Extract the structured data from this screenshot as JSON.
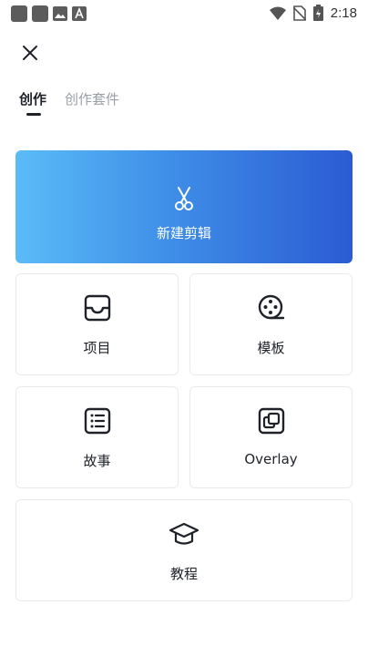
{
  "status_bar": {
    "time": "2:18",
    "icons": [
      "notification-square-icon",
      "notification-square-icon",
      "image-icon",
      "text-icon",
      "wifi-icon",
      "no-sim-icon",
      "battery-charging-icon"
    ]
  },
  "header": {
    "close_icon": "close-icon"
  },
  "tabs": [
    {
      "label": "创作",
      "active": true
    },
    {
      "label": "创作套件",
      "active": false
    }
  ],
  "hero": {
    "label": "新建剪辑",
    "icon": "scissors-icon",
    "colors": [
      "#5bbcf7",
      "#2b5bd3"
    ]
  },
  "cards": [
    {
      "label": "项目",
      "icon": "tray-icon"
    },
    {
      "label": "模板",
      "icon": "film-reel-icon"
    },
    {
      "label": "故事",
      "icon": "list-icon"
    },
    {
      "label": "Overlay",
      "icon": "overlay-icon"
    },
    {
      "label": "教程",
      "icon": "graduation-cap-icon"
    }
  ]
}
